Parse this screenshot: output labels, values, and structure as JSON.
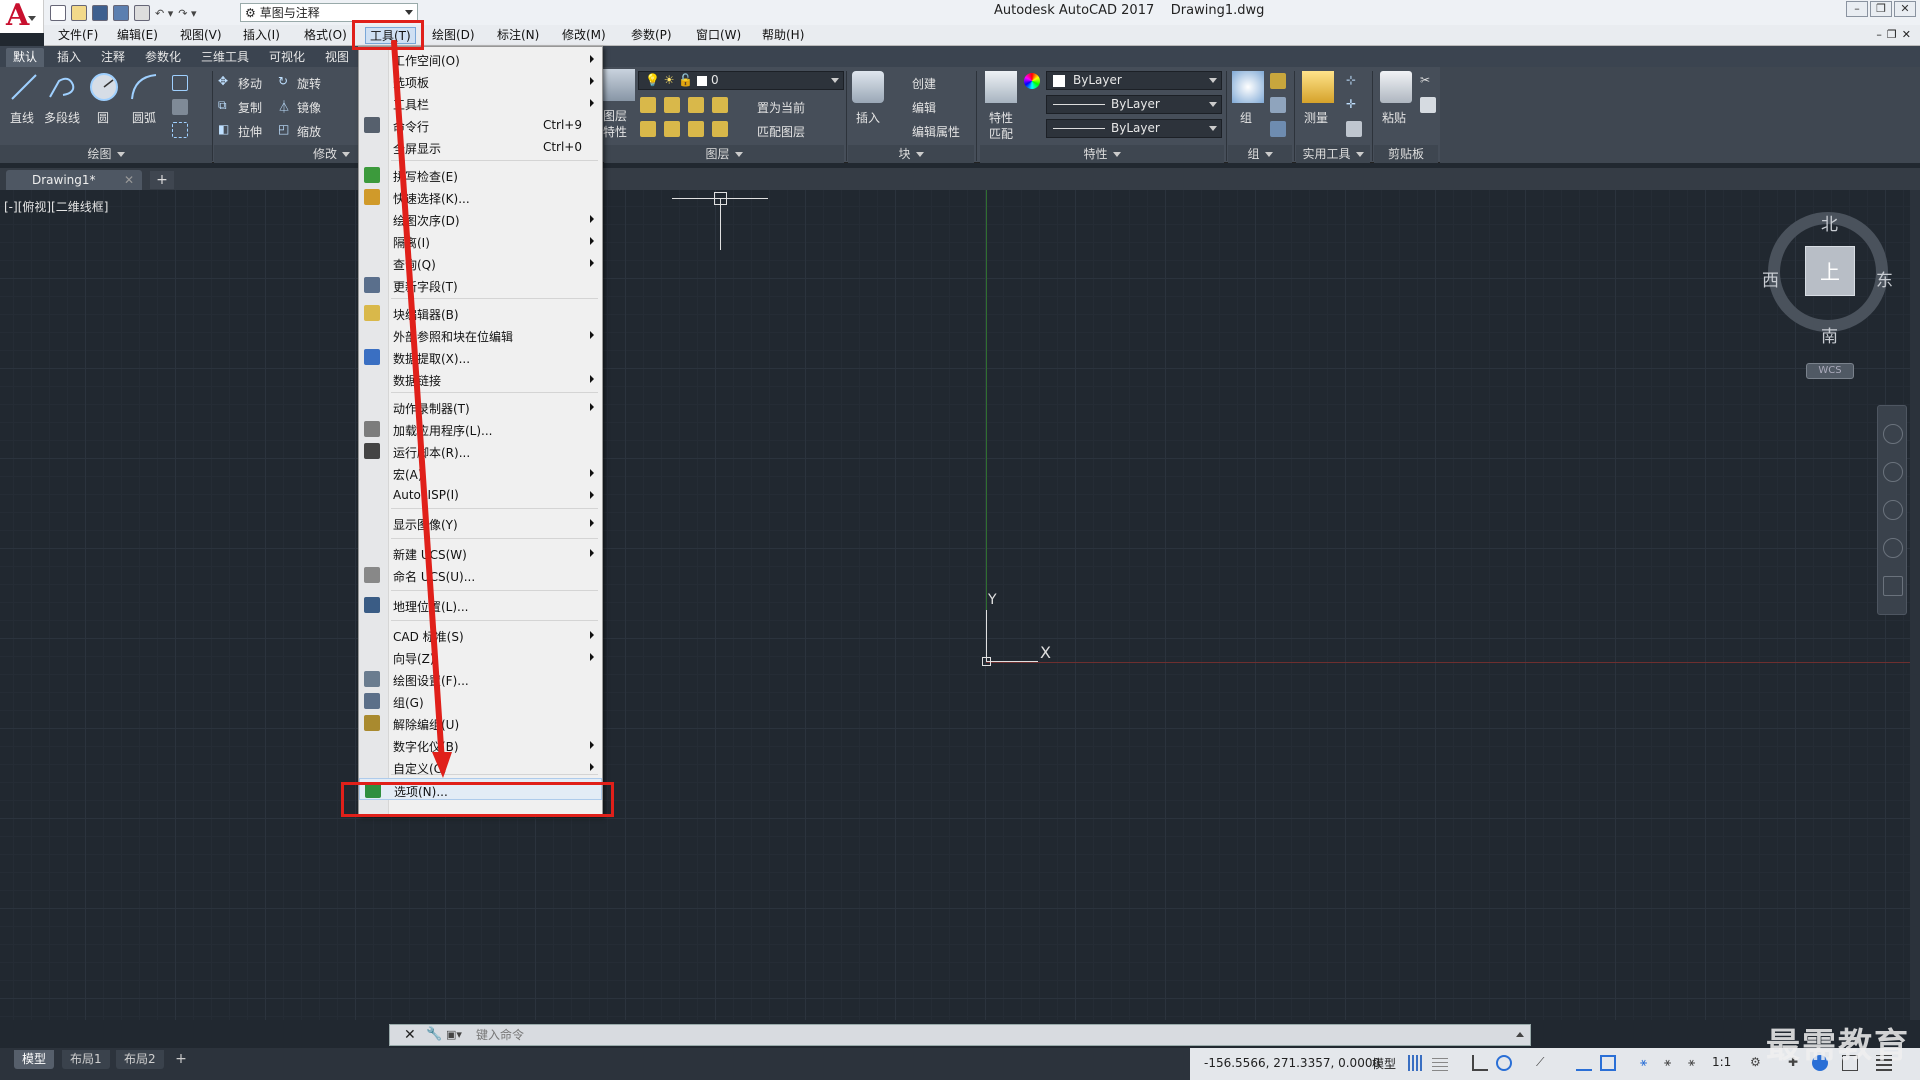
{
  "title_bar": {
    "workspace": "草图与注释",
    "title": "Autodesk AutoCAD 2017    Drawing1.dwg"
  },
  "menubar": {
    "items": [
      "文件(F)",
      "编辑(E)",
      "视图(V)",
      "插入(I)",
      "格式(O)",
      "工具(T)",
      "绘图(D)",
      "标注(N)",
      "修改(M)",
      "参数(P)",
      "窗口(W)",
      "帮助(H)"
    ],
    "active": "工具(T)"
  },
  "ribbon": {
    "tabs": [
      "默认",
      "插入",
      "注释",
      "参数化",
      "三维工具",
      "可视化",
      "视图"
    ],
    "active_tab": "默认",
    "draw": {
      "line": "直线",
      "polyline": "多段线",
      "circle": "圆",
      "arc": "圆弧",
      "panel": "绘图"
    },
    "modify": {
      "move": "移动",
      "rotate": "旋转",
      "copy": "复制",
      "mirror": "镜像",
      "stretch": "拉伸",
      "scale": "缩放",
      "panel": "修改"
    },
    "layers": {
      "layer_props_1": "图层",
      "layer_props_2": "特性",
      "current_layer": "0",
      "set_current": "置为当前",
      "match_layer": "匹配图层",
      "panel": "图层"
    },
    "block": {
      "insert": "插入",
      "create": "创建",
      "edit": "编辑",
      "edit_attr": "编辑属性",
      "panel": "块"
    },
    "properties": {
      "match_1": "特性",
      "match_2": "匹配",
      "color": "ByLayer",
      "linetype": "ByLayer",
      "lineweight": "ByLayer",
      "panel": "特性"
    },
    "groups": {
      "group": "组",
      "panel": "组"
    },
    "utilities": {
      "measure": "测量",
      "panel": "实用工具"
    },
    "clipboard": {
      "paste": "粘贴",
      "panel": "剪贴板"
    }
  },
  "document": {
    "tab": "Drawing1*",
    "add": "+"
  },
  "canvas": {
    "viewport_label": "[-][俯视][二维线框]",
    "ucs_x": "X",
    "ucs_y": "Y"
  },
  "viewcube": {
    "north": "北",
    "south": "南",
    "east": "东",
    "west": "西",
    "face": "上",
    "wcs": "WCS"
  },
  "tools_menu": {
    "items": [
      {
        "label": "工作空间(O)",
        "submenu": true
      },
      {
        "label": "选项板",
        "submenu": true
      },
      {
        "label": "工具栏",
        "submenu": true
      },
      {
        "label": "命令行",
        "shortcut": "Ctrl+9",
        "icon": "command-line-icon"
      },
      {
        "label": "全屏显示",
        "shortcut": "Ctrl+0"
      },
      {
        "label": "拼写检查(E)",
        "icon": "spell-check-icon"
      },
      {
        "label": "快速选择(K)...",
        "icon": "quick-select-icon"
      },
      {
        "label": "绘图次序(D)",
        "submenu": true
      },
      {
        "label": "隔离(I)",
        "submenu": true
      },
      {
        "label": "查询(Q)",
        "submenu": true
      },
      {
        "label": "更新字段(T)",
        "icon": "update-field-icon"
      },
      {
        "label": "块编辑器(B)",
        "icon": "block-editor-icon"
      },
      {
        "label": "外部参照和块在位编辑",
        "submenu": true
      },
      {
        "label": "数据提取(X)...",
        "icon": "data-extraction-icon"
      },
      {
        "label": "数据链接",
        "submenu": true
      },
      {
        "label": "动作录制器(T)",
        "submenu": true
      },
      {
        "label": "加载应用程序(L)...",
        "icon": "load-app-icon"
      },
      {
        "label": "运行脚本(R)...",
        "icon": "run-script-icon"
      },
      {
        "label": "宏(A)",
        "submenu": true
      },
      {
        "label": "AutoLISP(I)",
        "submenu": true
      },
      {
        "label": "显示图像(Y)",
        "submenu": true
      },
      {
        "label": "新建 UCS(W)",
        "submenu": true
      },
      {
        "label": "命名 UCS(U)...",
        "icon": "named-ucs-icon"
      },
      {
        "label": "地理位置(L)...",
        "icon": "geolocation-icon"
      },
      {
        "label": "CAD 标准(S)",
        "submenu": true
      },
      {
        "label": "向导(Z)",
        "submenu": true
      },
      {
        "label": "绘图设置(F)...",
        "icon": "drafting-settings-icon"
      },
      {
        "label": "组(G)",
        "icon": "group-icon"
      },
      {
        "label": "解除编组(U)",
        "icon": "ungroup-icon"
      },
      {
        "label": "数字化仪(B)",
        "submenu": true
      },
      {
        "label": "自定义(C)",
        "submenu": true
      },
      {
        "label": "选项(N)...",
        "icon": "options-icon",
        "highlighted": true
      }
    ]
  },
  "command_line": {
    "placeholder": "键入命令"
  },
  "layout_tabs": {
    "model": "模型",
    "layout1": "布局1",
    "layout2": "布局2",
    "add": "+"
  },
  "status_bar": {
    "coordinates": "-156.5566, 271.3357, 0.0000",
    "model": "模型",
    "scale": "1:1"
  },
  "watermark": "最需教育",
  "colors": {
    "annotation_red": "#e0201a",
    "menu_highlight": "#e3ecf6",
    "canvas_bg": "#212830",
    "logo_red": "#c8102e"
  }
}
